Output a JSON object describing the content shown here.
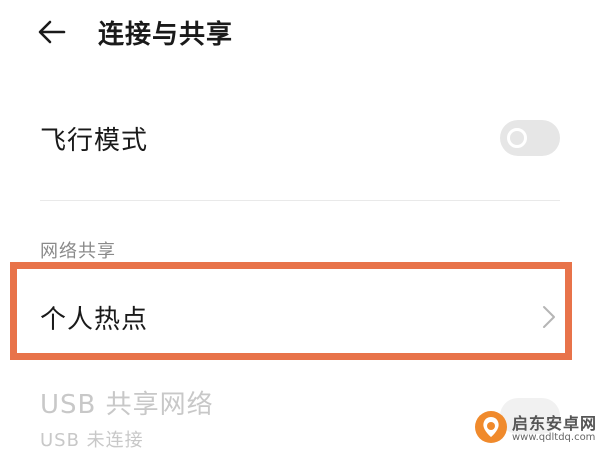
{
  "header": {
    "back_icon": "back-arrow-icon",
    "title": "连接与共享"
  },
  "airplane_mode": {
    "label": "飞行模式",
    "enabled": false
  },
  "network_sharing": {
    "section_title": "网络共享",
    "hotspot": {
      "label": "个人热点",
      "icon": "chevron-right-icon",
      "highlighted": true
    },
    "usb_tethering": {
      "label": "USB 共享网络",
      "status": "USB 未连接",
      "enabled": false,
      "disabled": true
    }
  },
  "colors": {
    "highlight": "#e8734a",
    "toggle_off": "#e6e6e6",
    "disabled_text": "#c8c8c8",
    "section_text": "#8a8a8a"
  },
  "watermark": {
    "name": "启东安卓网",
    "url": "www.qdltdq.com",
    "logo_color": "#f08a2c"
  }
}
